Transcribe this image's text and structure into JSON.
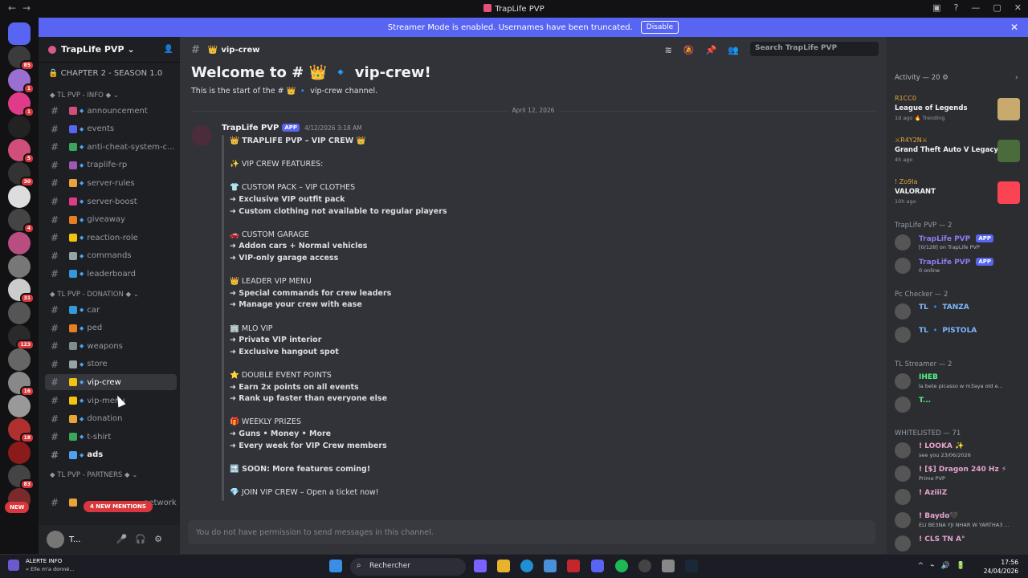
{
  "window": {
    "title": "TrapLife PVP"
  },
  "banner": {
    "text": "Streamer Mode is enabled. Usernames have been truncated.",
    "button": "Disable"
  },
  "servers": {
    "badges": [
      "85",
      "1",
      "1",
      "5",
      "30",
      "4",
      "31",
      "123",
      "16",
      "18",
      "83"
    ],
    "new_label": "NEW",
    "colors": [
      "#5865f2",
      "#3b3b3b",
      "#9b6fd1",
      "#e03a8a",
      "#222",
      "#d04f7a",
      "#333",
      "#ddd",
      "#444",
      "#b84d80",
      "#777",
      "#ccc",
      "#555",
      "#2a2a2a",
      "#666",
      "#888",
      "#999",
      "#b03030",
      "#8b1a1a",
      "#444",
      "#7a2a2a"
    ]
  },
  "sidebar": {
    "guild_name": "TrapLife PVP",
    "season": "CHAPTER 2 - SEASON 1.0",
    "categories": [
      {
        "label": "TL PVP - INFO",
        "channels": [
          {
            "name": "announcement",
            "color": "#d04f7a"
          },
          {
            "name": "events",
            "color": "#5865f2"
          },
          {
            "name": "anti-cheat-system-c...",
            "color": "#3ba55d"
          },
          {
            "name": "traplife-rp",
            "color": "#9b59b6"
          },
          {
            "name": "server-rules",
            "color": "#e8a33a"
          },
          {
            "name": "server-boost",
            "color": "#e03a8a"
          },
          {
            "name": "giveaway",
            "color": "#e67e22"
          },
          {
            "name": "reaction-role",
            "color": "#f1c40f"
          },
          {
            "name": "commands",
            "color": "#95a5a6"
          },
          {
            "name": "leaderboard",
            "color": "#3498db"
          }
        ]
      },
      {
        "label": "TL PVP - DONATION",
        "channels": [
          {
            "name": "car",
            "color": "#3498db"
          },
          {
            "name": "ped",
            "color": "#e67e22"
          },
          {
            "name": "weapons",
            "color": "#7f8c8d"
          },
          {
            "name": "store",
            "color": "#95a5a6"
          },
          {
            "name": "vip-crew",
            "color": "#f1c40f"
          },
          {
            "name": "vip-menu",
            "color": "#f1c40f"
          },
          {
            "name": "donation",
            "color": "#e8a33a"
          },
          {
            "name": "t-shirt",
            "color": "#3ba55d"
          },
          {
            "name": "ads",
            "color": "#4ea3f0"
          }
        ]
      },
      {
        "label": "TL PVP - PARTNERS",
        "channels": [
          {
            "name": "network",
            "color": "#e8a33a"
          }
        ]
      }
    ],
    "mentions": "4 NEW MENTIONS",
    "user": "T..."
  },
  "channel": {
    "name": "vip-crew",
    "welcome": "Welcome to # 👑 🔹 vip-crew!",
    "start": "This is the start of the # 👑 🔹 vip-crew channel.",
    "date": "April 12, 2026",
    "search_placeholder": "Search TrapLife PVP",
    "composer": "You do not have permission to send messages in this channel."
  },
  "message": {
    "author": "TrapLife PVP",
    "tag": "APP",
    "timestamp": "4/12/2026 3:18 AM",
    "lines": [
      {
        "text": "👑 TRAPLIFE PVP – VIP CREW 👑",
        "bold": true
      },
      {
        "text": "✨ VIP CREW FEATURES:",
        "bold": false
      },
      {
        "text": "👕 CUSTOM PACK – VIP CLOTHES",
        "bold": false
      },
      {
        "text": "➜ Exclusive VIP outfit pack",
        "bold": true
      },
      {
        "text": "➜ Custom clothing not available to regular players",
        "bold": true
      },
      {
        "text": "🚗 CUSTOM GARAGE",
        "bold": false
      },
      {
        "text": "➜ Addon cars + Normal vehicles",
        "bold": true
      },
      {
        "text": "➜ VIP-only garage access",
        "bold": true
      },
      {
        "text": "👑 LEADER VIP MENU",
        "bold": false
      },
      {
        "text": "➜ Special commands for crew leaders",
        "bold": true
      },
      {
        "text": "➜ Manage your crew with ease",
        "bold": true
      },
      {
        "text": "🏢 MLO VIP",
        "bold": false
      },
      {
        "text": "➜ Private VIP interior",
        "bold": true
      },
      {
        "text": "➜ Exclusive hangout spot",
        "bold": true
      },
      {
        "text": "⭐ DOUBLE EVENT POINTS",
        "bold": false
      },
      {
        "text": "➜ Earn 2x points on all events",
        "bold": true
      },
      {
        "text": "➜ Rank up faster than everyone else",
        "bold": true
      },
      {
        "text": "🎁 WEEKLY PRIZES",
        "bold": false
      },
      {
        "text": "➜ Guns • Money • More",
        "bold": true
      },
      {
        "text": "➜ Every week for VIP Crew members",
        "bold": true
      },
      {
        "text": "🔜 SOON: More features coming!",
        "bold": true
      },
      {
        "text": "💎 JOIN VIP CREW – Open a ticket now!",
        "bold": false
      }
    ]
  },
  "members": {
    "activity": "Activity — 20",
    "games": [
      {
        "user": "R1CC0",
        "title": "League of Legends",
        "meta": "1d ago  🔥 Trending",
        "color": "#c8aa6e"
      },
      {
        "user": "⚔R4Y2N⚔",
        "title": "Grand Theft Auto V Legacy",
        "meta": "4h ago",
        "color": "#4a6b3a"
      },
      {
        "user": "! Zo9la",
        "title": "VALORANT",
        "meta": "10h ago",
        "color": "#fa4454"
      }
    ],
    "groups": [
      {
        "label": "TrapLife PVP — 2",
        "members": [
          {
            "name": "TrapLife PVP",
            "status": "[0/128] on TrapLife PVP",
            "color": "#8f7bf0",
            "app": true
          },
          {
            "name": "TrapLife PVP",
            "status": "0 online",
            "color": "#8f7bf0",
            "app": true
          }
        ]
      },
      {
        "label": "Pc Checker — 2",
        "members": [
          {
            "name": "TL 🔹 TANZA",
            "status": "",
            "color": "#7eb6ff",
            "app": false
          },
          {
            "name": "TL 🔹 PISTOLA",
            "status": "",
            "color": "#7eb6ff",
            "app": false
          }
        ]
      },
      {
        "label": "TL Streamer — 2",
        "members": [
          {
            "name": "IHEB",
            "status": "la bete picasso w m3aya old e...",
            "color": "#57f287",
            "app": false
          },
          {
            "name": "T...",
            "status": "",
            "color": "#57f287",
            "app": false
          }
        ]
      },
      {
        "label": "WHITELISTED — 71",
        "members": [
          {
            "name": "! LOOKA ✨",
            "status": "see you 23/06/2026",
            "color": "#e8a3d0",
            "app": false
          },
          {
            "name": "! [$] Dragon 240 Hz ⚡",
            "status": "Prime PVP",
            "color": "#e8a3d0",
            "app": false
          },
          {
            "name": "! AziiiZ",
            "status": "",
            "color": "#e8a3d0",
            "app": false
          },
          {
            "name": "! Baydo🖤",
            "status": "ELI BE3NA YJI NHAR W YARTHA3 ...",
            "color": "#e8a3d0",
            "app": false
          },
          {
            "name": "! CLS TN A°",
            "status": "",
            "color": "#e8a3d0",
            "app": false
          }
        ]
      }
    ]
  },
  "taskbar": {
    "alert_title": "ALERTE INFO",
    "alert_sub": "« Elle m'a donné...",
    "search": "Rechercher",
    "time": "17:56",
    "date": "24/04/2026"
  }
}
